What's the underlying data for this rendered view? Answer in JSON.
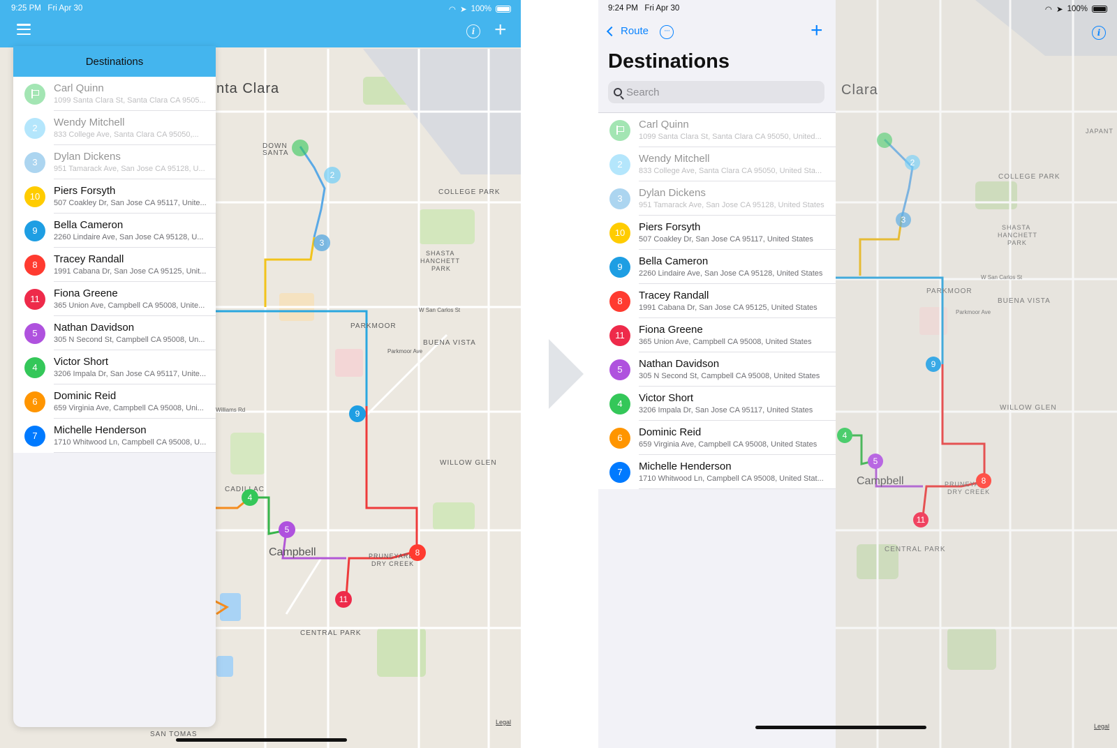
{
  "left": {
    "status": {
      "time": "9:25 PM",
      "date": "Fri Apr 30",
      "battery": "100%"
    },
    "popover_title": "Destinations",
    "legal": "Legal",
    "map_labels": {
      "city": "nta Clara",
      "downtown": "DOWN\nSANTA",
      "college_park": "COLLEGE PARK",
      "shasta": "SHASTA\nHANCHETT\nPARK",
      "parkmoor": "PARKMOOR",
      "buena_vista": "BUENA VISTA",
      "willow_glen": "WILLOW GLEN",
      "campbell": "Campbell",
      "pruneyard": "PRUNEYARD\nDRY CREEK",
      "central_park": "CENTRAL PARK",
      "cadillac": "CADILLAC",
      "san_tomas": "SAN TOMAS",
      "san_carlos": "W San Carlos St",
      "parkmoor_ave": "Parkmoor Ave",
      "williams": "Williams Rd"
    }
  },
  "right": {
    "status": {
      "time": "9:24 PM",
      "date": "Fri Apr 30",
      "battery": "100%"
    },
    "back_label": "Route",
    "more_label": "···",
    "title": "Destinations",
    "search_placeholder": "Search",
    "legal": "Legal",
    "map_labels": {
      "city": "Clara",
      "college_park": "COLLEGE PARK",
      "shasta": "SHASTA\nHANCHETT\nPARK",
      "parkmoor": "PARKMOOR",
      "buena_vista": "BUENA VISTA",
      "willow_glen": "WILLOW GLEN",
      "campbell": "Campbell",
      "pruneyard": "PRUNEYARD\nDRY CREEK",
      "central_park": "CENTRAL PARK",
      "japantown": "JAPANT",
      "san_carlos": "W San Carlos St",
      "parkmoor_ave": "Parkmoor Ave"
    }
  },
  "destinations_left": [
    {
      "badge": "",
      "icon": "flag-icon",
      "color": "#34c759",
      "name": "Carl Quinn",
      "address": "1099 Santa Clara St, Santa Clara CA 9505...",
      "faded": true
    },
    {
      "badge": "2",
      "color": "#5ac8fa",
      "name": "Wendy Mitchell",
      "address": "833 College Ave, Santa Clara CA 95050,...",
      "faded": true
    },
    {
      "badge": "3",
      "color": "#4aa3df",
      "name": "Dylan Dickens",
      "address": "951 Tamarack Ave, San Jose CA 95128, U...",
      "faded": true
    },
    {
      "badge": "10",
      "color": "#ffcc00",
      "name": "Piers Forsyth",
      "address": "507 Coakley Dr, San Jose CA 95117, Unite...",
      "faded": false
    },
    {
      "badge": "9",
      "color": "#1e9ee3",
      "name": "Bella Cameron",
      "address": "2260 Lindaire Ave, San Jose CA 95128, U...",
      "faded": false
    },
    {
      "badge": "8",
      "color": "#ff3b30",
      "name": "Tracey Randall",
      "address": "1991 Cabana Dr, San Jose CA 95125, Unit...",
      "faded": false
    },
    {
      "badge": "11",
      "color": "#ee2a4a",
      "name": "Fiona Greene",
      "address": "365 Union Ave, Campbell CA 95008, Unite...",
      "faded": false
    },
    {
      "badge": "5",
      "color": "#af52de",
      "name": "Nathan Davidson",
      "address": "305 N Second St, Campbell CA 95008, Un...",
      "faded": false
    },
    {
      "badge": "4",
      "color": "#34c759",
      "name": "Victor Short",
      "address": "3206 Impala Dr, San Jose CA 95117, Unite...",
      "faded": false
    },
    {
      "badge": "6",
      "color": "#ff9500",
      "name": "Dominic Reid",
      "address": "659 Virginia Ave, Campbell CA 95008, Uni...",
      "faded": false
    },
    {
      "badge": "7",
      "color": "#007aff",
      "name": "Michelle Henderson",
      "address": "1710 Whitwood Ln, Campbell CA 95008, U...",
      "faded": false
    }
  ],
  "destinations_right": [
    {
      "badge": "",
      "icon": "flag-icon",
      "color": "#34c759",
      "name": "Carl Quinn",
      "address": "1099 Santa Clara St, Santa Clara CA 95050, United...",
      "faded": true
    },
    {
      "badge": "2",
      "color": "#5ac8fa",
      "name": "Wendy Mitchell",
      "address": "833 College Ave, Santa Clara CA 95050, United Sta...",
      "faded": true
    },
    {
      "badge": "3",
      "color": "#4aa3df",
      "name": "Dylan Dickens",
      "address": "951 Tamarack Ave, San Jose CA 95128, United States",
      "faded": true
    },
    {
      "badge": "10",
      "color": "#ffcc00",
      "name": "Piers Forsyth",
      "address": "507 Coakley Dr, San Jose CA 95117, United States",
      "faded": false
    },
    {
      "badge": "9",
      "color": "#1e9ee3",
      "name": "Bella Cameron",
      "address": "2260 Lindaire Ave, San Jose CA 95128, United States",
      "faded": false
    },
    {
      "badge": "8",
      "color": "#ff3b30",
      "name": "Tracey Randall",
      "address": "1991 Cabana Dr, San Jose CA 95125, United States",
      "faded": false
    },
    {
      "badge": "11",
      "color": "#ee2a4a",
      "name": "Fiona Greene",
      "address": "365 Union Ave, Campbell CA 95008, United States",
      "faded": false
    },
    {
      "badge": "5",
      "color": "#af52de",
      "name": "Nathan Davidson",
      "address": "305 N Second St, Campbell CA 95008, United States",
      "faded": false
    },
    {
      "badge": "4",
      "color": "#34c759",
      "name": "Victor Short",
      "address": "3206 Impala Dr, San Jose CA 95117, United States",
      "faded": false
    },
    {
      "badge": "6",
      "color": "#ff9500",
      "name": "Dominic Reid",
      "address": "659 Virginia Ave, Campbell CA 95008, United States",
      "faded": false
    },
    {
      "badge": "7",
      "color": "#007aff",
      "name": "Michelle Henderson",
      "address": "1710 Whitwood Ln, Campbell CA 95008, United Stat...",
      "faded": false
    }
  ],
  "map_pins_left": [
    "2",
    "3",
    "9",
    "4",
    "5",
    "8",
    "11"
  ],
  "map_pins_right": [
    "2",
    "3",
    "9",
    "4",
    "5",
    "8",
    "11"
  ]
}
